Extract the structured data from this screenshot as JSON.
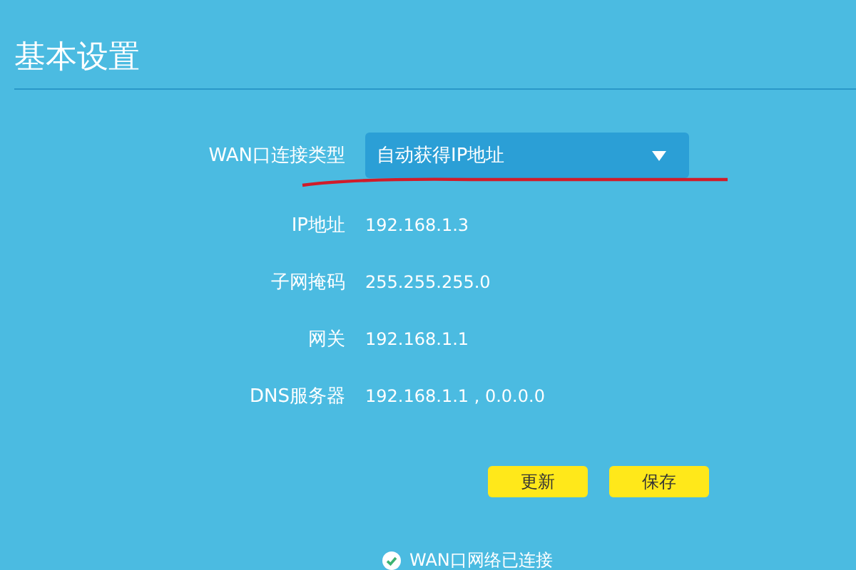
{
  "title": "基本设置",
  "fields": [
    {
      "kind": "select",
      "label": "WAN口连接类型",
      "value": "自动获得IP地址"
    },
    {
      "kind": "text",
      "label": "IP地址",
      "value": "192.168.1.3"
    },
    {
      "kind": "text",
      "label": "子网掩码",
      "value": "255.255.255.0"
    },
    {
      "kind": "text",
      "label": "网关",
      "value": "192.168.1.1"
    },
    {
      "kind": "text",
      "label": "DNS服务器",
      "value": "192.168.1.1 , 0.0.0.0"
    }
  ],
  "buttons": [
    "更新",
    "保存"
  ],
  "status": {
    "text": "WAN口网络已连接",
    "connected": true
  }
}
